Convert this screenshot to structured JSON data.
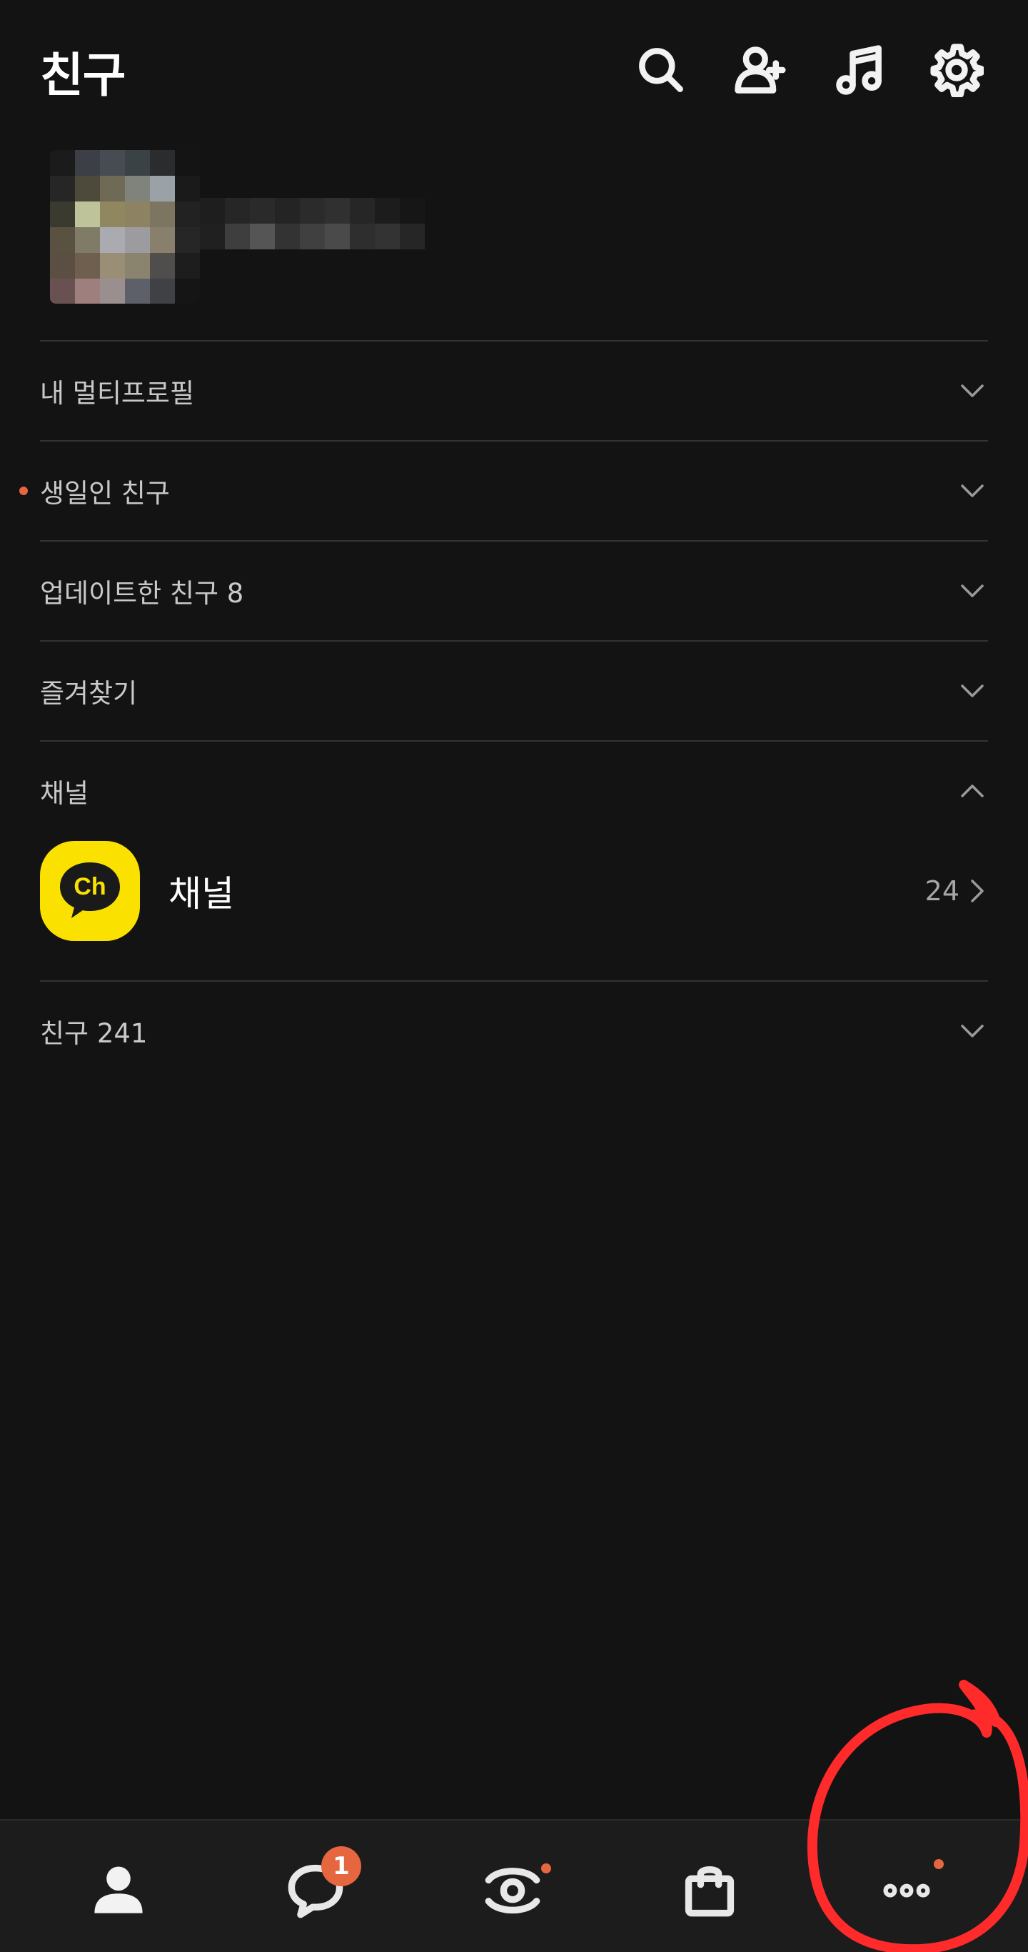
{
  "header": {
    "title": "친구",
    "icons": [
      "search-icon",
      "add-friend-icon",
      "music-icon",
      "settings-icon"
    ]
  },
  "sections": [
    {
      "label": "내 멀티프로필",
      "expanded": false,
      "new_dot": false
    },
    {
      "label": "생일인 친구",
      "expanded": false,
      "new_dot": true
    },
    {
      "label": "업데이트한 친구 8",
      "expanded": false,
      "new_dot": false
    },
    {
      "label": "즐겨찾기",
      "expanded": false,
      "new_dot": false
    },
    {
      "label": "채널",
      "expanded": true,
      "new_dot": false
    },
    {
      "label": "친구 241",
      "expanded": false,
      "new_dot": false
    }
  ],
  "channel": {
    "logo_text": "Ch",
    "name": "채널",
    "count": "24"
  },
  "tabbar": {
    "tabs": [
      "friends-tab",
      "chats-tab",
      "view-tab",
      "shopping-tab",
      "more-tab"
    ],
    "chats_badge": "1"
  },
  "colors": {
    "background": "#131313",
    "accent_dot": "#e5663f",
    "channel_yellow": "#fae100",
    "annotation_red": "#ff2a2a"
  }
}
